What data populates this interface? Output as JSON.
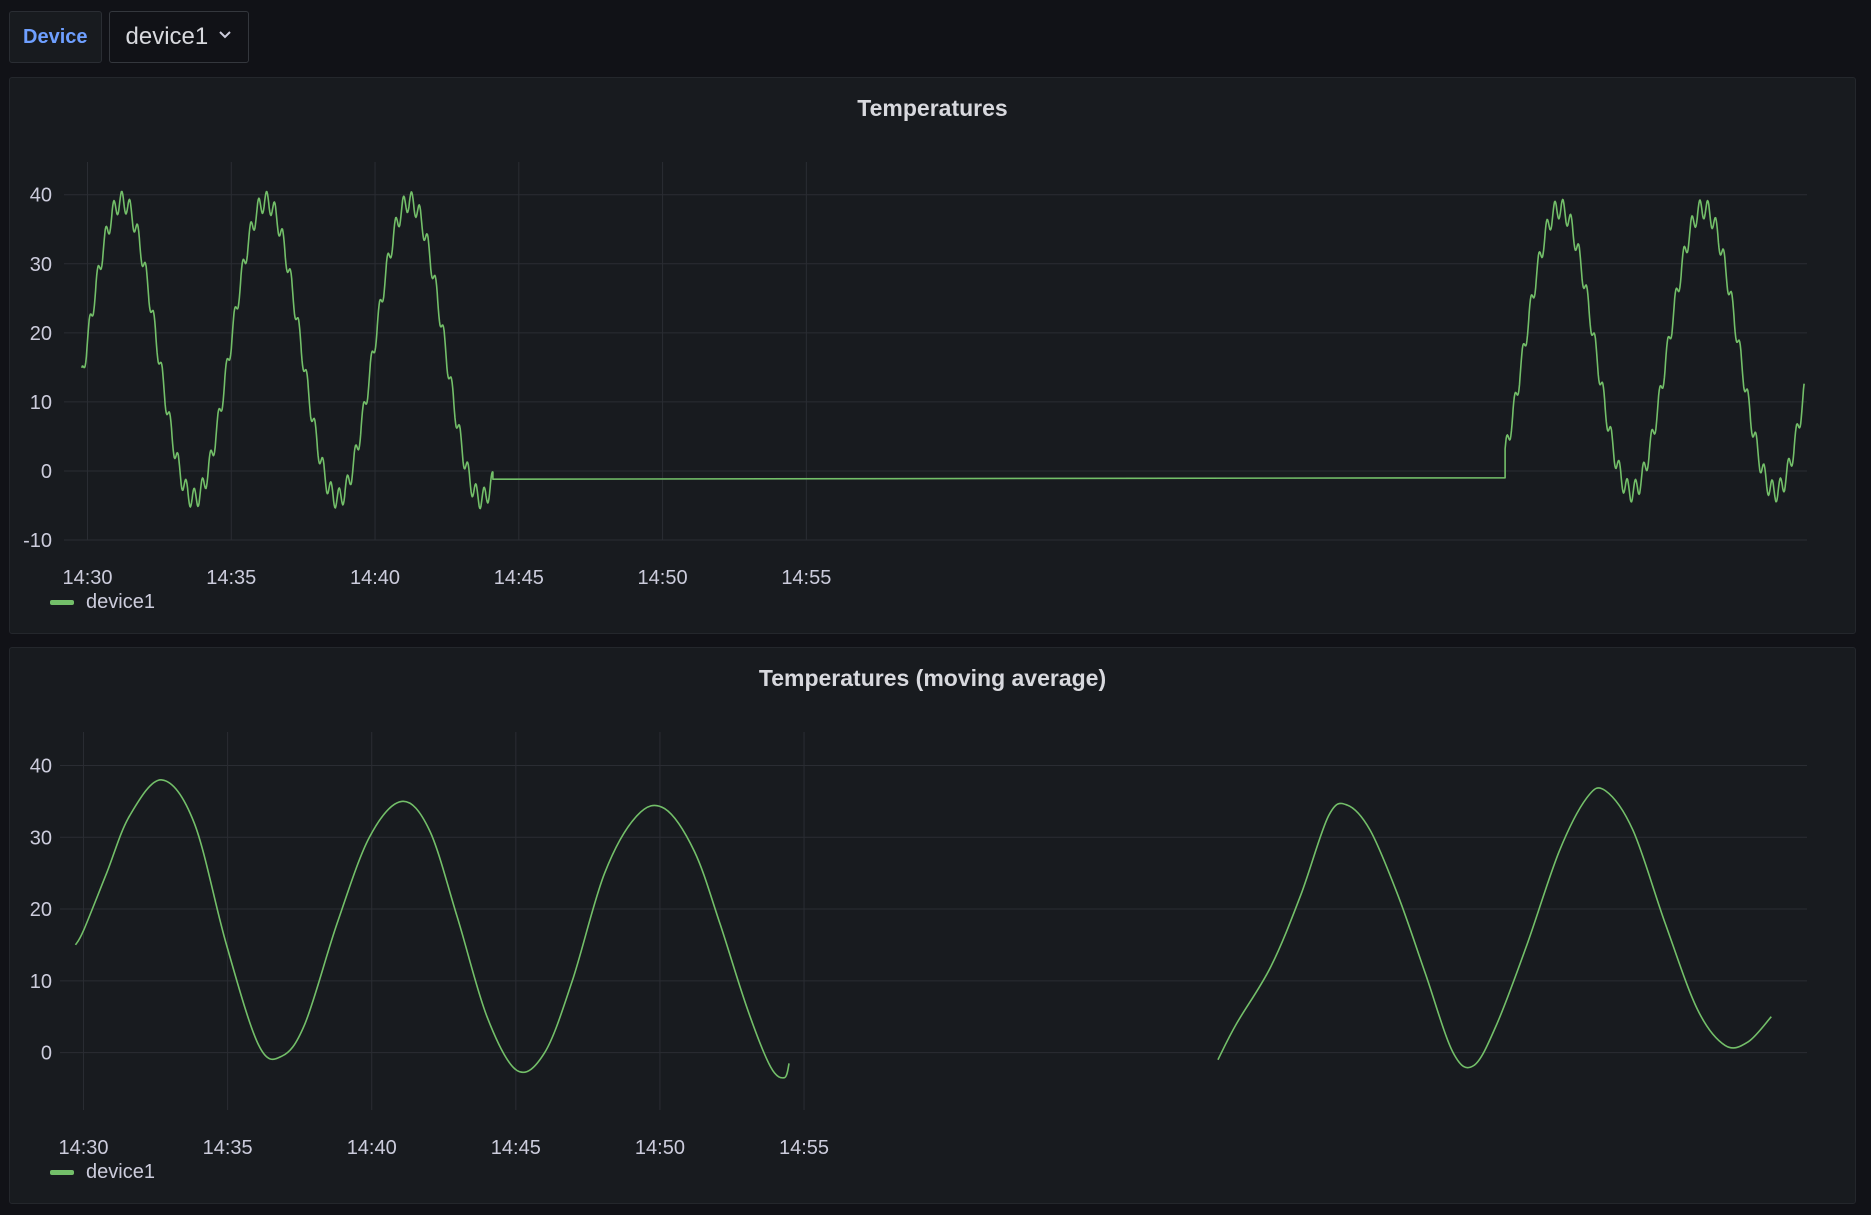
{
  "variables": {
    "label": "Device",
    "selected": "device1"
  },
  "colors": {
    "series": "#73bf69",
    "grid": "#2a2d33",
    "panel_bg": "#181b1f",
    "page_bg": "#111217",
    "variable_label": "#6e9fff"
  },
  "icons": {
    "dropdown": "chevron-down-icon"
  },
  "panels": [
    {
      "title": "Temperatures",
      "legend": "device1"
    },
    {
      "title": "Temperatures (moving average)",
      "legend": "device1"
    }
  ],
  "chart_data": [
    {
      "type": "line",
      "title": "Temperatures",
      "x_ticks": [
        "14:30",
        "14:35",
        "14:40",
        "14:45",
        "14:50",
        "14:55"
      ],
      "y_ticks": [
        -10,
        0,
        10,
        20,
        30,
        40
      ],
      "ylim": [
        -10,
        43
      ],
      "xlim_minutes": [
        -0.4,
        59.8
      ],
      "grid": true,
      "legend_position": "bottom-left",
      "series": [
        {
          "name": "device1",
          "description": "Noisy sinusoid, period ~5 min, amplitude ~21 with ~1.5 ripple; peaks ~40, 37.5, 35.5, 36, 38.5; troughs ~-2, -4, -5, -3, -1; flat line at about -1 between 14:44 and 14:49",
          "segments": [
            {
              "start_min": -0.2,
              "end_min": 14.1,
              "mid": 17.5,
              "amp": 21.5,
              "period": 5.0,
              "phase_min": 1.2
            },
            {
              "start_min": 49.3,
              "end_min": 59.7,
              "mid": 17.5,
              "amp": 20.5,
              "period": 5.0,
              "phase_min": 51.2
            }
          ],
          "flat": {
            "from": [
              14.1,
              -1.2
            ],
            "to": [
              49.3,
              -1.0
            ]
          },
          "ripple_amp": 1.5,
          "ripple_period": 0.28
        }
      ]
    },
    {
      "type": "line",
      "title": "Temperatures (moving average)",
      "x_ticks": [
        "14:30",
        "14:35",
        "14:40",
        "14:45",
        "14:50",
        "14:55"
      ],
      "y_ticks": [
        0,
        10,
        20,
        30,
        40
      ],
      "ylim": [
        -8,
        43
      ],
      "xlim_minutes": [
        -0.4,
        59.8
      ],
      "grid": true,
      "legend_position": "bottom-left",
      "series": [
        {
          "name": "device1",
          "description": "Smoothed sinusoid; peaks ~38, 35, 34, 34.5, 36.5; troughs ~-0.5, -3, -3.5, -2, 0.5; gap between ~14:44 and ~14:49",
          "points": [
            [
              -0.35,
              15
            ],
            [
              0,
              17
            ],
            [
              1,
              25
            ],
            [
              2,
              33
            ],
            [
              3.4,
              38
            ],
            [
              4.8,
              32
            ],
            [
              6.2,
              15
            ],
            [
              7.6,
              1
            ],
            [
              8.6,
              -0.5
            ],
            [
              9.6,
              4
            ],
            [
              11,
              18
            ],
            [
              12.4,
              30
            ],
            [
              13.8,
              35
            ],
            [
              15,
              31
            ],
            [
              16.2,
              19
            ],
            [
              17.5,
              5
            ],
            [
              18.8,
              -2.5
            ],
            [
              20,
              0
            ],
            [
              21.2,
              10
            ],
            [
              22.6,
              25
            ],
            [
              24,
              33
            ],
            [
              25.2,
              34
            ],
            [
              26.5,
              28
            ],
            [
              27.6,
              18
            ],
            [
              28.8,
              6
            ],
            [
              29.8,
              -2
            ],
            [
              30.4,
              -3.5
            ],
            [
              30.6,
              -1.5
            ],
            null,
            [
              49.2,
              -1
            ],
            [
              50,
              4
            ],
            [
              51.5,
              12
            ],
            [
              52.8,
              22
            ],
            [
              54,
              33
            ],
            [
              54.8,
              34.5
            ],
            [
              55.8,
              31
            ],
            [
              57,
              22
            ],
            [
              58.2,
              11
            ],
            [
              59.4,
              0
            ],
            [
              60.3,
              -1.8
            ],
            [
              61.3,
              4
            ],
            [
              62.6,
              15
            ],
            [
              64,
              28
            ],
            [
              65.2,
              35.5
            ],
            [
              66,
              36.5
            ],
            [
              67.2,
              31
            ],
            [
              68.6,
              18
            ],
            [
              70,
              6
            ],
            [
              71.2,
              1
            ],
            [
              72.2,
              1.5
            ],
            [
              73.2,
              5
            ]
          ],
          "x_scale_note": "x in minutes after 14:30 scaled ×0.8 for the visible 60-minute window"
        }
      ]
    }
  ]
}
